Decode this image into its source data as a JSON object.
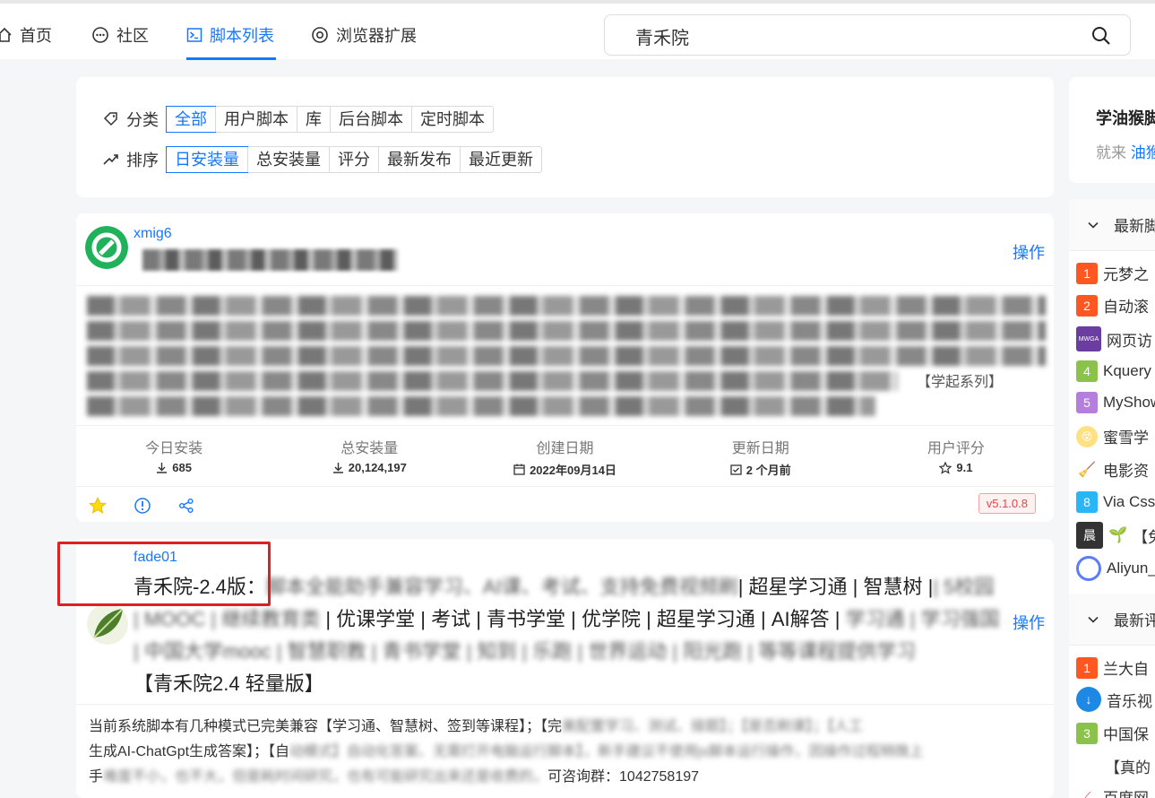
{
  "nav": {
    "home": "首页",
    "community": "社区",
    "scripts": "脚本列表",
    "extensions": "浏览器扩展",
    "search_value": "青禾院"
  },
  "filters": {
    "category_label": "分类",
    "categories": [
      "全部",
      "用户脚本",
      "库",
      "后台脚本",
      "定时脚本"
    ],
    "sort_label": "排序",
    "sorts": [
      "日安装量",
      "总安装量",
      "评分",
      "最新发布",
      "最近更新"
    ]
  },
  "script1": {
    "author": "xmig6",
    "op": "操作",
    "desc_tail": "【学起系列】",
    "stats": [
      {
        "k": "今日安装",
        "v": "685"
      },
      {
        "k": "总安装量",
        "v": "20,124,197"
      },
      {
        "k": "创建日期",
        "v": "2022年09月14日"
      },
      {
        "k": "更新日期",
        "v": "2 个月前"
      },
      {
        "k": "用户评分",
        "v": "9.1"
      }
    ],
    "version": "v5.1.0.8"
  },
  "script2": {
    "author": "fade01",
    "op": "操作",
    "title_start": "青禾院-2.4版：",
    "title_seg2": "| 超星学习通 | 智慧树 |",
    "title_line2": "| 优课学堂 | 考试 | 青书学堂 | 优学院 | 超星学习通 | AI解答 |",
    "title_end": "【青禾院2.4 轻量版】",
    "desc_l1": "当前系统脚本有几种模式已完美兼容【学习通、智慧树、签到等课程】；【完",
    "desc_l2a": "生成AI-ChatGpt生成答案】；【自",
    "desc_l3a": "手",
    "desc_l3b": "可咨询群：1042758197"
  },
  "sidebar": {
    "promo_title": "学油猴脚",
    "promo_sub": "就来 ",
    "promo_link": "油猴",
    "section1": "最新脚",
    "list1": [
      {
        "n": "1",
        "label": "元梦之",
        "color": "#ff5722"
      },
      {
        "n": "2",
        "label": "自动滚",
        "color": "#ff5722"
      },
      {
        "n": "",
        "label": "网页访",
        "color": "#6a3ea1"
      },
      {
        "n": "4",
        "label": "Kquery",
        "color": "#8bc34a"
      },
      {
        "n": "5",
        "label": "MyShow",
        "color": "#b57edc"
      },
      {
        "n": "",
        "label": "蜜雪学",
        "color": "#ffc107"
      },
      {
        "n": "",
        "label": "电影资",
        "color": "#2e7d32"
      },
      {
        "n": "8",
        "label": "Via Css",
        "color": "#29b6f6"
      },
      {
        "n": "",
        "label": "【免",
        "color": "#333333"
      },
      {
        "n": "",
        "label": "Aliyun_",
        "color": "#5c7cfa"
      }
    ],
    "section2": "最新评",
    "list2": [
      {
        "n": "1",
        "label": "兰大自",
        "color": "#ff5722"
      },
      {
        "n": "",
        "label": "音乐视",
        "color": "#1e88e5"
      },
      {
        "n": "3",
        "label": "中国保",
        "color": "#8bc34a"
      },
      {
        "n": "",
        "label": "【真的",
        "color": "#ffffff"
      },
      {
        "n": "",
        "label": "百度网",
        "color": "#e91e63"
      }
    ]
  }
}
